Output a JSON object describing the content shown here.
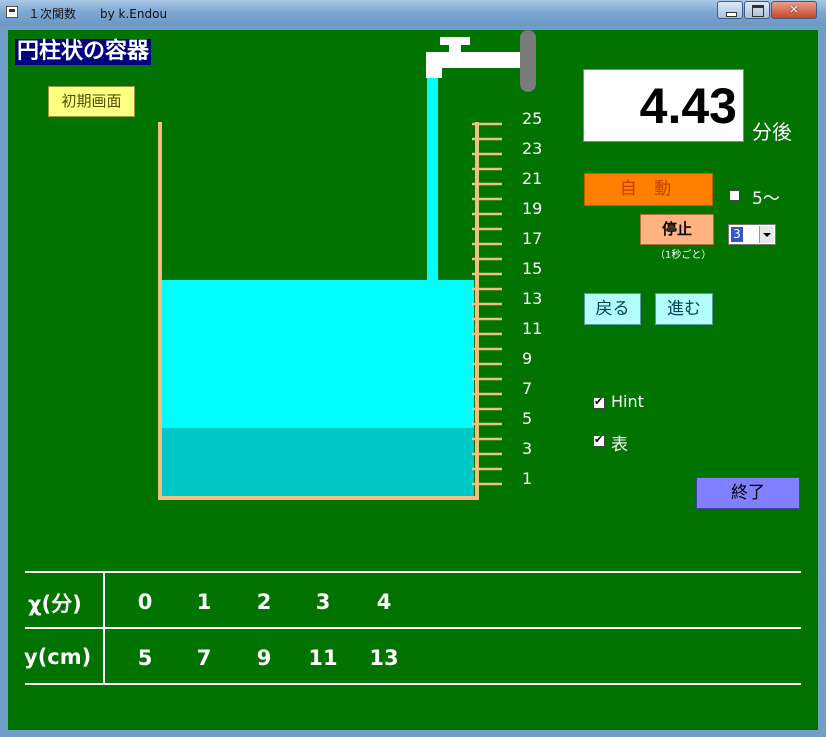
{
  "window": {
    "title": "１次関数　　by k.Endou",
    "close_label": "✕"
  },
  "app": {
    "title": "円柱状の容器",
    "init_button": "初期画面"
  },
  "scale": {
    "labels": [
      "25",
      "23",
      "21",
      "19",
      "17",
      "15",
      "13",
      "11",
      "9",
      "7",
      "5",
      "3",
      "1"
    ]
  },
  "water": {
    "level_cm": 14,
    "initial_level_cm": 5,
    "max_cm": 26
  },
  "colors": {
    "background": "#007300",
    "water_light": "#00ffff",
    "water_dark": "#00c8c8",
    "container": "#f0c080"
  },
  "timer": {
    "value": "4.43",
    "unit": "分後"
  },
  "controls": {
    "auto_label": "自 動",
    "five_label": "5～",
    "stop_label": "停止",
    "stop_note": "（1秒ごと）",
    "interval_value": "3",
    "back_label": "戻る",
    "next_label": "進む",
    "hint_label": "Hint",
    "table_label": "表",
    "end_label": "終了"
  },
  "table": {
    "x_header": "χ(分)",
    "y_header": "y(cm)",
    "x_values": [
      "0",
      "1",
      "2",
      "3",
      "4"
    ],
    "y_values": [
      "5",
      "7",
      "9",
      "11",
      "13"
    ]
  }
}
